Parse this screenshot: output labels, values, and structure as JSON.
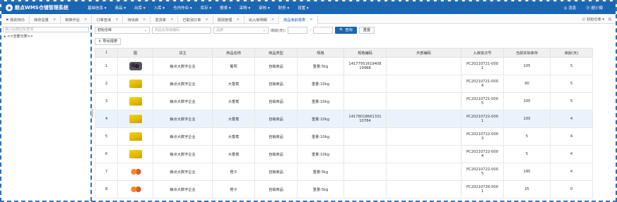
{
  "app": {
    "title": "鲸点WMS仓储管理系统",
    "logo_glyph": "◉"
  },
  "menu": [
    "基础信息 ▾",
    "商品 ▾",
    "出库 ▾",
    "入库 ▾",
    "仓内作业 ▾",
    "库存 ▾",
    "报表 ▾",
    "采购 ▾",
    "审核 ▾",
    "财务 ▾",
    "设置 ▾"
  ],
  "topright": {
    "messages": "◎ 消息",
    "user": "Ⓐ 超小猿"
  },
  "tabs": [
    {
      "label": "⚑ 我的待办",
      "close": ""
    },
    {
      "label": "库存总量",
      "close": "×"
    },
    {
      "label": "制单作业",
      "close": "×"
    },
    {
      "label": "订单查询",
      "close": "×"
    },
    {
      "label": "待出库",
      "close": "×"
    },
    {
      "label": "发货单",
      "close": "×"
    },
    {
      "label": "已取消订单",
      "close": "×"
    },
    {
      "label": "报损管理",
      "close": "×"
    },
    {
      "label": "出入库明细",
      "close": "×"
    },
    {
      "label": "商品库龄报表",
      "close": "×"
    }
  ],
  "tabsright": {
    "warehouse": "⛫ 初始仓库 ▾",
    "extra": "G"
  },
  "sidebar": {
    "search_placeholder": "输入后按回车查询",
    "tree_root": "▸ <<全部分类>>"
  },
  "filters": {
    "warehouse": "初始仓库",
    "goods_placeholder": "商品名称或编码",
    "brand_placeholder": "品牌",
    "age_label": "库龄(天):",
    "age_sep": "-",
    "search": "🔍 查询",
    "reset": "重置"
  },
  "export_label": "导出报表",
  "export_icon": "⬆",
  "table": {
    "columns": [
      "⋮",
      "图",
      "货主",
      "商品名称",
      "商品类型",
      "规格",
      "规格编码",
      "外部编码",
      "入库批次号",
      "当前实际库存",
      "库龄(天)"
    ],
    "rows": [
      {
        "no": "1",
        "img": "grape",
        "owner": "鲸点大数字企业",
        "name": "葡萄",
        "type": "自销商品",
        "spec": "重量:5kg",
        "code": "14177951619408\n19968",
        "ext": "",
        "batch": "PC20210721-000\n1",
        "stock": "105",
        "age": "5"
      },
      {
        "no": "2",
        "img": "banana",
        "owner": "鲸点大数字企业",
        "name": "大香蕉",
        "type": "自销商品",
        "spec": "重量:10kg",
        "code": "",
        "ext": "",
        "batch": "PC20210721-000\n4",
        "stock": "90",
        "age": "5"
      },
      {
        "no": "3",
        "img": "banana",
        "owner": "鲸点大数字企业",
        "name": "大香蕉",
        "type": "自销商品",
        "spec": "重量:10kg",
        "code": "",
        "ext": "",
        "batch": "PC20210721-000\n5",
        "stock": "100",
        "age": "5"
      },
      {
        "no": "4",
        "img": "banana",
        "owner": "鲸点大数字企业",
        "name": "大香蕉",
        "type": "自销商品",
        "spec": "重量:10kg",
        "code": "14178018661331\n10784",
        "ext": "",
        "batch": "PC20210722-000\n1",
        "stock": "100",
        "age": "4"
      },
      {
        "no": "5",
        "img": "banana",
        "owner": "鲸点大数字企业",
        "name": "大香蕉",
        "type": "自销商品",
        "spec": "重量:10kg",
        "code": "",
        "ext": "",
        "batch": "PC20210722-000\n3",
        "stock": "5",
        "age": "4"
      },
      {
        "no": "6",
        "img": "banana",
        "owner": "鲸点大数字企业",
        "name": "大香蕉",
        "type": "自销商品",
        "spec": "重量:10kg",
        "code": "",
        "ext": "",
        "batch": "PC20210722-000\n4",
        "stock": "5",
        "age": "4"
      },
      {
        "no": "7",
        "img": "orange",
        "owner": "鲸点大数字企业",
        "name": "橙子",
        "type": "自销商品",
        "spec": "重量:5kg",
        "code": "",
        "ext": "",
        "batch": "PC20210722-000\n5",
        "stock": "180",
        "age": "4"
      },
      {
        "no": "8",
        "img": "orange",
        "owner": "鲸点大数字企业",
        "name": "橙子",
        "type": "自销商品",
        "spec": "重量:5kg",
        "code": "",
        "ext": "",
        "batch": "PC20210726-000\n1",
        "stock": "25",
        "age": "0"
      }
    ]
  }
}
